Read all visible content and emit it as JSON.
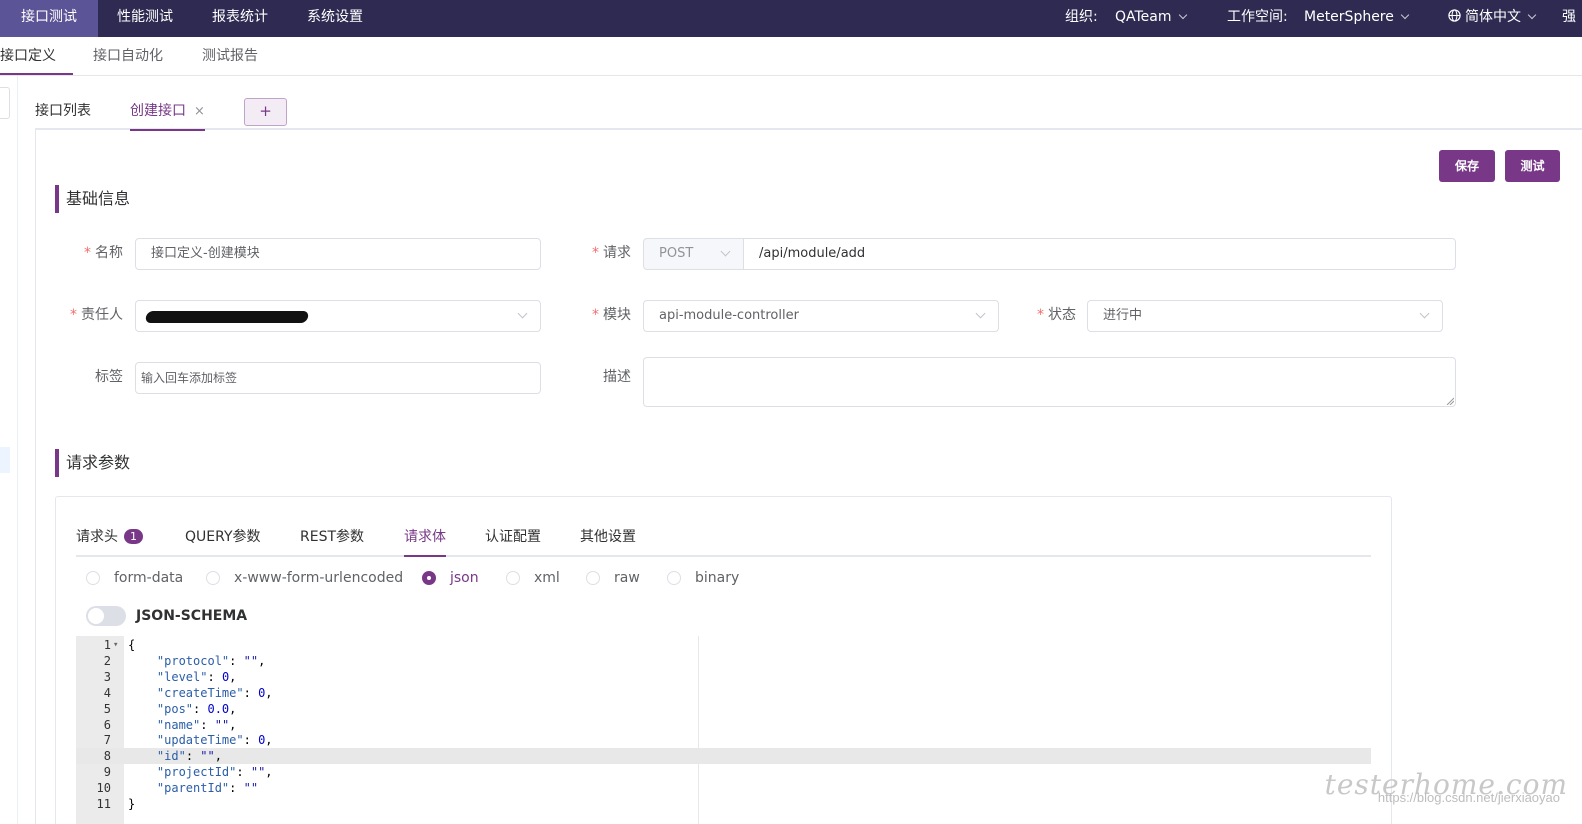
{
  "topnav": {
    "items": [
      "接口测试",
      "性能测试",
      "报表统计",
      "系统设置"
    ],
    "org_label": "组织:",
    "org_value": "QATeam",
    "ws_label": "工作空间:",
    "ws_value": "MeterSphere",
    "lang": "简体中文",
    "overflow": "强"
  },
  "subnav": {
    "items": [
      "接口定义",
      "接口自动化",
      "测试报告"
    ]
  },
  "tabs": {
    "list": "接口列表",
    "create": "创建接口",
    "close": "×",
    "add": "+"
  },
  "buttons": {
    "save": "保存",
    "test": "测试"
  },
  "basic": {
    "title": "基础信息",
    "name_label": "名称",
    "name_value": "接口定义-创建模块",
    "request_label": "请求",
    "method": "POST",
    "path": "/api/module/add",
    "owner_label": "责任人",
    "module_label": "模块",
    "module_value": "api-module-controller",
    "status_label": "状态",
    "status_value": "进行中",
    "tag_label": "标签",
    "tag_placeholder": "输入回车添加标签",
    "desc_label": "描述",
    "required_mark": "*"
  },
  "params": {
    "title": "请求参数",
    "tabs": [
      "请求头",
      "QUERY参数",
      "REST参数",
      "请求体",
      "认证配置",
      "其他设置"
    ],
    "header_badge": "1",
    "body_types": [
      "form-data",
      "x-www-form-urlencoded",
      "json",
      "xml",
      "raw",
      "binary"
    ],
    "selected_body_type": "json",
    "json_schema_label": "JSON-SCHEMA",
    "json_schema_enabled": false
  },
  "editor": {
    "lines": [
      {
        "n": "1",
        "code": "{"
      },
      {
        "n": "2",
        "key": "\"protocol\"",
        "val": "\"\"",
        "type": "s",
        "comma": ","
      },
      {
        "n": "3",
        "key": "\"level\"",
        "val": "0",
        "type": "n",
        "comma": ","
      },
      {
        "n": "4",
        "key": "\"createTime\"",
        "val": "0",
        "type": "n",
        "comma": ","
      },
      {
        "n": "5",
        "key": "\"pos\"",
        "val": "0.0",
        "type": "n",
        "comma": ","
      },
      {
        "n": "6",
        "key": "\"name\"",
        "val": "\"\"",
        "type": "s",
        "comma": ","
      },
      {
        "n": "7",
        "key": "\"updateTime\"",
        "val": "0",
        "type": "n",
        "comma": ","
      },
      {
        "n": "8",
        "key": "\"id\"",
        "val": "\"\"",
        "type": "s",
        "comma": ",",
        "highlight": true
      },
      {
        "n": "9",
        "key": "\"projectId\"",
        "val": "\"\"",
        "type": "s",
        "comma": ","
      },
      {
        "n": "10",
        "key": "\"parentId\"",
        "val": "\"\"",
        "type": "s",
        "comma": ""
      },
      {
        "n": "11",
        "code": "}"
      }
    ]
  },
  "watermark": {
    "brand": "testerhome.com",
    "url": "https://blog.csdn.net/jierxiaoyao"
  },
  "colors": {
    "primary": "#783887",
    "nav_bg": "#2e2a51",
    "nav_active": "#5b5496"
  }
}
